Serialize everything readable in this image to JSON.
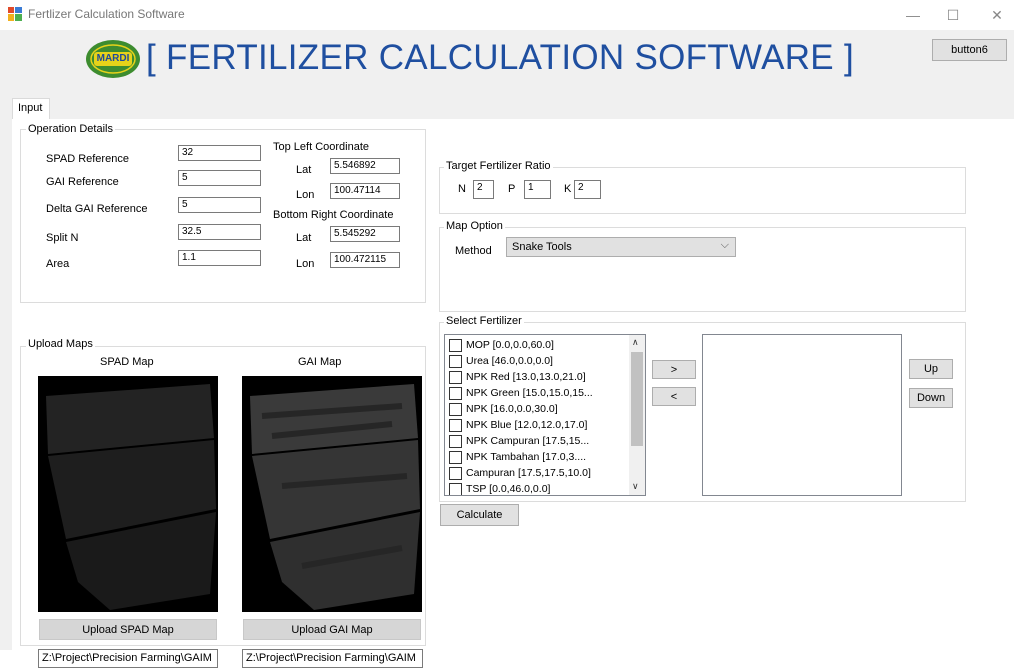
{
  "window": {
    "title": "Fertlizer Calculation Software"
  },
  "header": {
    "logo_text": "MARDI",
    "title": "[ FERTILIZER CALCULATION SOFTWARE ]",
    "button6_label": "button6"
  },
  "tabs": [
    {
      "label": "Input"
    }
  ],
  "operation": {
    "group_label": "Operation Details",
    "spad_label": "SPAD Reference",
    "spad_value": "32",
    "gai_label": "GAI Reference",
    "gai_value": "5",
    "delta_label": "Delta GAI Reference",
    "delta_value": "5",
    "split_label": "Split N",
    "split_value": "32.5",
    "area_label": "Area",
    "area_value": "1.1",
    "top_left_label": "Top Left Coordinate",
    "tl_lat_label": "Lat",
    "tl_lat_value": "5.546892",
    "tl_lon_label": "Lon",
    "tl_lon_value": "100.47114",
    "bottom_right_label": "Bottom Right Coordinate",
    "br_lat_label": "Lat",
    "br_lat_value": "5.545292",
    "br_lon_label": "Lon",
    "br_lon_value": "100.472115"
  },
  "upload": {
    "group_label": "Upload  Maps",
    "spad_title": "SPAD Map",
    "gai_title": "GAI Map",
    "spad_button": "Upload SPAD Map",
    "gai_button": "Upload GAI Map",
    "spad_path": "Z:\\Project\\Precision Farming\\GAIM",
    "gai_path": "Z:\\Project\\Precision Farming\\GAIM"
  },
  "ratio": {
    "group_label": "Target Fertilizer Ratio",
    "n_label": "N",
    "n_value": "2",
    "p_label": "P",
    "p_value": "1",
    "k_label": "K",
    "k_value": "2"
  },
  "map_option": {
    "group_label": "Map Option",
    "method_label": "Method",
    "method_value": "Snake Tools"
  },
  "select_fertilizer": {
    "group_label": "Select Fertilizer",
    "items": [
      "MOP [0.0,0.0,60.0]",
      "Urea [46.0,0.0,0.0]",
      "NPK Red [13.0,13.0,21.0]",
      "NPK Green [15.0,15.0,15...",
      "NPK [16.0,0.0,30.0]",
      "NPK Blue [12.0,12.0,17.0]",
      "NPK Campuran [17.5,15...",
      "NPK Tambahan [17.0,3....",
      "Campuran [17.5,17.5,10.0]",
      "TSP [0.0,46.0,0.0]"
    ],
    "add_button": ">",
    "remove_button": "<",
    "up_button": "Up",
    "down_button": "Down"
  },
  "calculate_button": "Calculate",
  "colors": {
    "title_blue": "#1f4fa0",
    "logo_green": "#3d8c2f",
    "logo_yellow": "#e6d21a"
  }
}
